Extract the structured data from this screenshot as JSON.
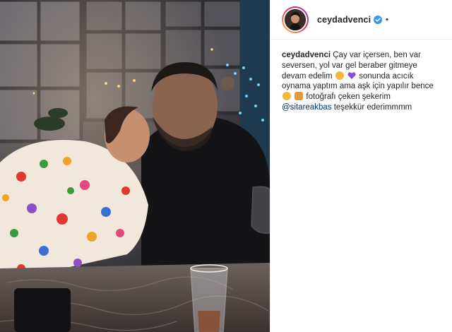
{
  "post": {
    "author": {
      "username": "ceydadvenci",
      "verified": true,
      "avatar_icon": "profile-photo-avatar"
    },
    "header_separator": "•",
    "caption": {
      "username": "ceydadvenci",
      "part1": "Çay var içersen, ben var seversen, yol var gel beraber gitmeye devam edelim",
      "part2": "sonunda acıcık oynama yaptım ama aşk için yapılır bence",
      "part3": "fotoğrafı çeken şekerim",
      "mention": "@sitareakbas",
      "part4": "teşekkür ederimmmm",
      "emojis": [
        "grinning-face-emoji",
        "purple-heart-emoji",
        "star-struck-emoji",
        "hands-emoji"
      ]
    }
  },
  "colors": {
    "verified_blue": "#3897f0",
    "mention_blue": "#003569",
    "text": "#262626",
    "border": "#efefef",
    "heart_purple": "#8a4bd6"
  }
}
